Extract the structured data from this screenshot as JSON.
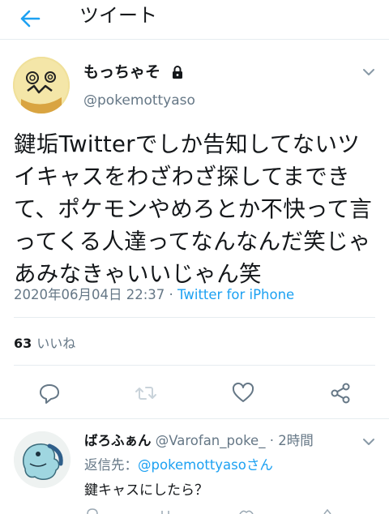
{
  "header": {
    "title": "ツイート"
  },
  "tweet": {
    "display_name": "もっちゃそ",
    "username": "@pokemottyaso",
    "text": "鍵垢Twitterでしか告知してないツイキャスをわざわざ探してまできて、ポケモンやめろとか不快って言ってくる人達ってなんなんだ笑じゃあみなきゃいいじゃん笑",
    "timestamp": "2020年06月04日 22:37",
    "separator": "·",
    "source": "Twitter for iPhone",
    "likes_count": "63",
    "likes_label": "いいね"
  },
  "reply": {
    "display_name": "ばろふぁん",
    "username": "@Varofan_poke_",
    "separator": "·",
    "time": "2時間",
    "reply_to_label": "返信先：",
    "reply_to_mention": "@pokemottyasoさん",
    "text": "鍵キャスにしたら？"
  },
  "colors": {
    "accent": "#1da1f2",
    "muted": "#657786",
    "text": "#14171a",
    "divider": "#e6ecf0"
  },
  "icons": [
    "back-arrow-icon",
    "lock-icon",
    "chevron-down-icon",
    "reply-icon",
    "retweet-icon",
    "like-icon",
    "share-icon"
  ]
}
